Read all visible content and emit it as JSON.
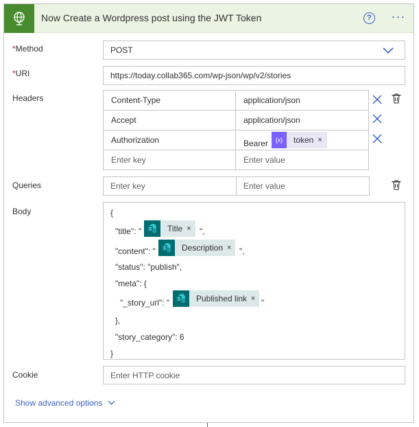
{
  "action": {
    "title": "Now Create a Wordpress post using the JWT Token",
    "icon": "globe-icon",
    "help_label": "?",
    "more_label": "···",
    "accent": "#488b2e"
  },
  "fields": {
    "method": {
      "required_mark": "*",
      "label": "Method",
      "value": "POST"
    },
    "uri": {
      "required_mark": "*",
      "label": "URI",
      "value": "https://today.collab365.com/wp-json/wp/v2/stories"
    },
    "headers": {
      "label": "Headers",
      "rows": [
        {
          "key": "Content-Type",
          "value": "application/json"
        },
        {
          "key": "Accept",
          "value": "application/json"
        },
        {
          "key": "Authorization",
          "value_prefix": "Bearer",
          "token": {
            "icon_label": "{x}",
            "label": "token",
            "remove": "×"
          }
        }
      ],
      "key_placeholder": "Enter key",
      "value_placeholder": "Enter value"
    },
    "queries": {
      "label": "Queries",
      "key_placeholder": "Enter key",
      "value_placeholder": "Enter value"
    },
    "body": {
      "label": "Body",
      "lines": {
        "open": "{",
        "title_key": "\"title\": \"",
        "title_token": "Title",
        "title_end": "\",",
        "content_key": "\"content\": \"",
        "content_token": "Description",
        "content_end": "\",",
        "status": "\"status\": \"publish\",",
        "meta_open": "\"meta\": {",
        "story_url_key": "\"_story_url\": \"",
        "story_url_token": "Published link",
        "story_url_end": "\"",
        "meta_close": "},",
        "category": "\"story_category\": 6",
        "close": "}"
      },
      "token_remove": "×"
    },
    "cookie": {
      "label": "Cookie",
      "placeholder": "Enter HTTP cookie"
    }
  },
  "advanced": {
    "label": "Show advanced options"
  }
}
